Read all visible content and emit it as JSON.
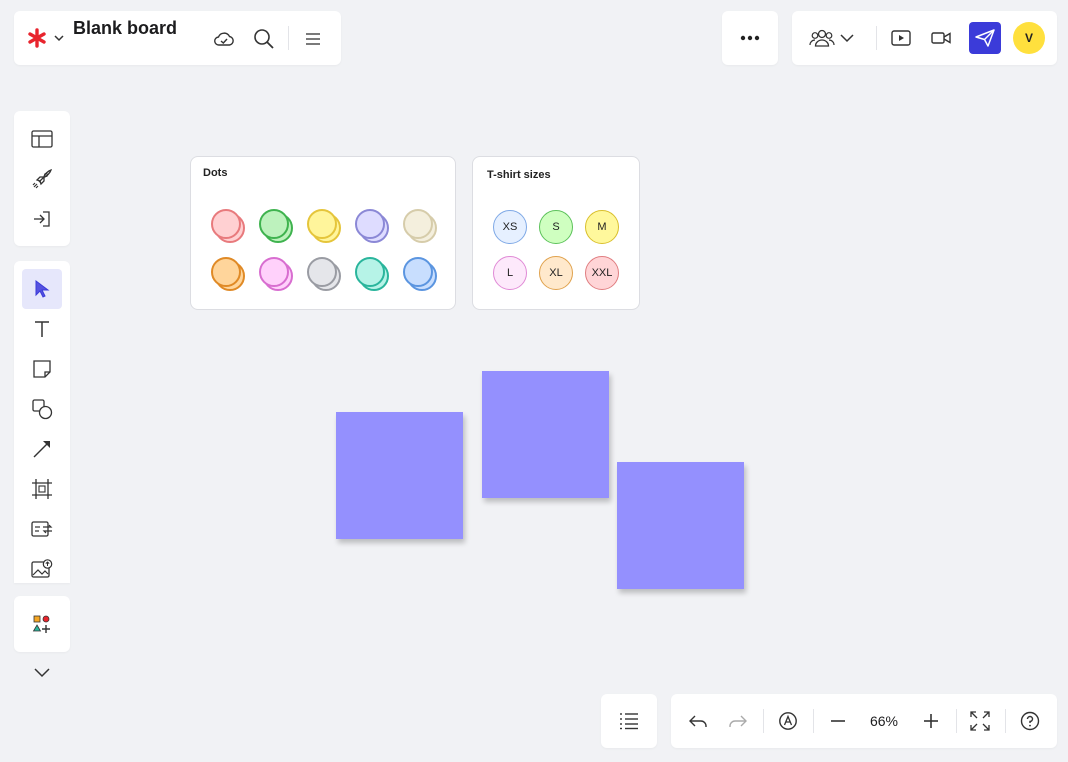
{
  "header": {
    "board_title": "Blank board"
  },
  "frames": {
    "dots": {
      "title": "Dots",
      "dots": [
        {
          "fill": "#ffd0d2",
          "stroke": "#e87a7d"
        },
        {
          "fill": "#bdf2bd",
          "stroke": "#3fb34f"
        },
        {
          "fill": "#fff59b",
          "stroke": "#e5c53b"
        },
        {
          "fill": "#dedcff",
          "stroke": "#8b88d6"
        },
        {
          "fill": "#f4efdd",
          "stroke": "#d6ccaa"
        },
        {
          "fill": "#ffd59b",
          "stroke": "#e08a26"
        },
        {
          "fill": "#ffd1fb",
          "stroke": "#d86ed0"
        },
        {
          "fill": "#e5e6ea",
          "stroke": "#9a9ca3"
        },
        {
          "fill": "#b6f3e7",
          "stroke": "#2ab59c"
        },
        {
          "fill": "#c8defe",
          "stroke": "#5b95e0"
        }
      ]
    },
    "tshirt": {
      "title": "T-shirt sizes",
      "sizes": [
        {
          "label": "XS",
          "fill": "#e6f0ff",
          "stroke": "#7fa9e6"
        },
        {
          "label": "S",
          "fill": "#cfffc0",
          "stroke": "#5cc25a"
        },
        {
          "label": "M",
          "fill": "#fff89c",
          "stroke": "#d9bf2c"
        },
        {
          "label": "L",
          "fill": "#fde9fb",
          "stroke": "#e08ad6"
        },
        {
          "label": "XL",
          "fill": "#ffe9cc",
          "stroke": "#e0a24d"
        },
        {
          "label": "XXL",
          "fill": "#ffd5d7",
          "stroke": "#e07d80"
        }
      ]
    }
  },
  "stickies": {
    "color": "#9490fe"
  },
  "zoom": {
    "value": "66%"
  },
  "colors": {
    "background": "#f1f2f5",
    "accent": "#3b3bd9",
    "avatar": "#ffe03d",
    "brand": "#e8242d",
    "selected_tool": "#e6e7fb"
  },
  "icons": {
    "logo": "asterisk-logo",
    "avatar_letter": "V"
  }
}
